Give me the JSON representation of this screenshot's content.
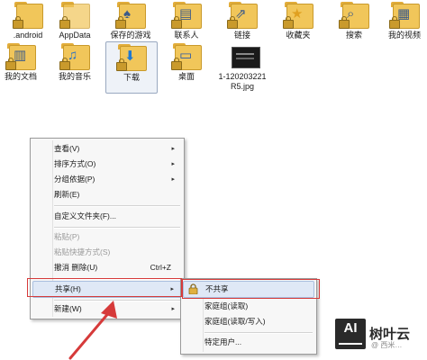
{
  "row1": [
    {
      "label": ".android",
      "icon": "folder-icon"
    },
    {
      "label": "AppData",
      "icon": "folder-icon"
    },
    {
      "label": "保存的游戏",
      "icon": "saved-games-icon"
    },
    {
      "label": "联系人",
      "icon": "contacts-icon"
    },
    {
      "label": "链接",
      "icon": "links-icon"
    },
    {
      "label": "收藏夹",
      "icon": "favorites-icon"
    },
    {
      "label": "搜索",
      "icon": "search-icon"
    },
    {
      "label": "我的视频",
      "icon": "videos-icon"
    }
  ],
  "row2": [
    {
      "label": "我的文档",
      "icon": "documents-icon"
    },
    {
      "label": "我的音乐",
      "icon": "music-icon"
    },
    {
      "label": "下载",
      "icon": "downloads-icon"
    },
    {
      "label": "桌面",
      "icon": "desktop-icon"
    },
    {
      "label_line1": "1-120203221",
      "label_line2": "R5.jpg",
      "icon": "image-file-icon"
    }
  ],
  "context_menu": {
    "items": [
      {
        "label": "查看(V)",
        "submenu": true
      },
      {
        "label": "排序方式(O)",
        "submenu": true
      },
      {
        "label": "分组依据(P)",
        "submenu": true
      },
      {
        "label": "刷新(E)"
      },
      {
        "label": "自定义文件夹(F)..."
      },
      {
        "label": "粘贴(P)",
        "disabled": true
      },
      {
        "label": "粘贴快捷方式(S)",
        "disabled": true
      },
      {
        "label": "撤消 删除(U)",
        "shortcut": "Ctrl+Z"
      },
      {
        "label": "共享(H)",
        "submenu": true,
        "highlighted": true
      },
      {
        "label": "新建(W)",
        "submenu": true
      }
    ]
  },
  "share_submenu": {
    "items": [
      {
        "label": "不共享",
        "icon": "lock-icon",
        "highlighted": true
      },
      {
        "label": "家庭组(读取)"
      },
      {
        "label": "家庭组(读取/写入)"
      },
      {
        "label": "特定用户..."
      }
    ]
  },
  "watermark": {
    "logo": "AI",
    "brand": "树叶云",
    "sub": "@ 西米…"
  },
  "colors": {
    "highlight_box": "#d63a3a",
    "arrow": "#d63a3a",
    "menu_bg": "#f7f7f7",
    "folder": "#f1c65a"
  }
}
